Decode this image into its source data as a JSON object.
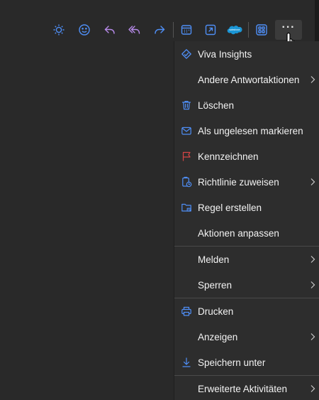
{
  "toolbar": {
    "buttons": [
      {
        "icon": "sun-icon"
      },
      {
        "icon": "emoji-icon"
      },
      {
        "icon": "reply-icon"
      },
      {
        "icon": "reply-all-icon"
      },
      {
        "icon": "forward-icon"
      },
      {
        "icon": "calendar-icon"
      },
      {
        "icon": "open-in-window-icon"
      },
      {
        "icon": "salesforce-icon",
        "text": "salesforce"
      },
      {
        "icon": "apps-icon"
      },
      {
        "icon": "more-options-icon",
        "text": "···"
      }
    ],
    "accent": "#4f8ff7",
    "purple": "#b68ae9"
  },
  "menu": {
    "items": [
      {
        "label": "Viva Insights",
        "icon": "viva-insights-icon",
        "submenu": false
      },
      {
        "label": "Andere Antwortaktionen",
        "icon": null,
        "submenu": true
      },
      {
        "label": "Löschen",
        "icon": "trash-icon",
        "submenu": false
      },
      {
        "label": "Als ungelesen markieren",
        "icon": "envelope-icon",
        "submenu": false
      },
      {
        "label": "Kennzeichnen",
        "icon": "flag-icon",
        "submenu": false
      },
      {
        "label": "Richtlinie zuweisen",
        "icon": "policy-icon",
        "submenu": true
      },
      {
        "label": "Regel erstellen",
        "icon": "folder-rule-icon",
        "submenu": false
      },
      {
        "label": "Aktionen anpassen",
        "icon": null,
        "submenu": false
      },
      {
        "label": "Melden",
        "icon": null,
        "submenu": true
      },
      {
        "label": "Sperren",
        "icon": null,
        "submenu": true
      },
      {
        "label": "Drucken",
        "icon": "printer-icon",
        "submenu": false
      },
      {
        "label": "Anzeigen",
        "icon": null,
        "submenu": true
      },
      {
        "label": "Speichern unter",
        "icon": "download-icon",
        "submenu": false
      },
      {
        "label": "Erweiterte Aktivitäten",
        "icon": null,
        "submenu": true
      }
    ]
  }
}
